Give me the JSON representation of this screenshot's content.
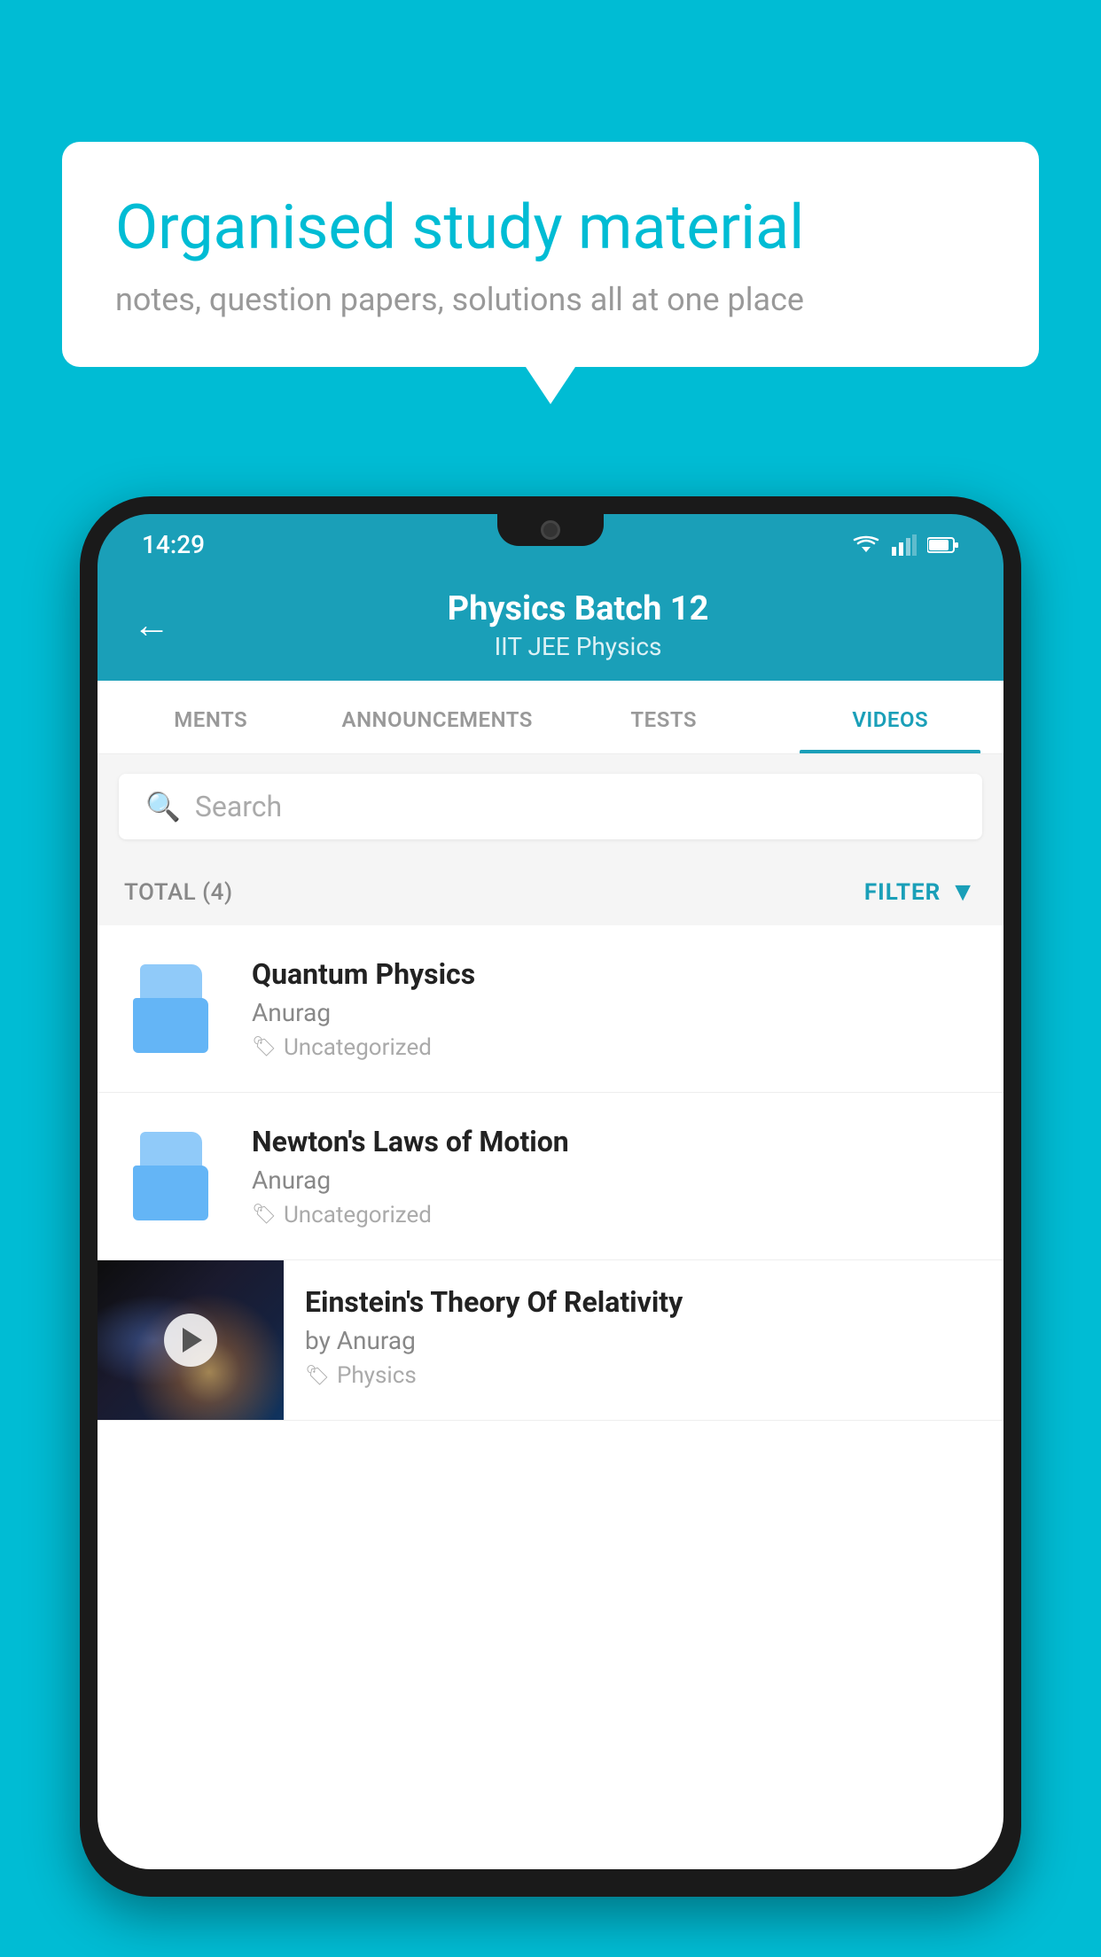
{
  "background": {
    "color": "#00BCD4"
  },
  "speech_bubble": {
    "title": "Organised study material",
    "subtitle": "notes, question papers, solutions all at one place"
  },
  "status_bar": {
    "time": "14:29"
  },
  "app_header": {
    "title": "Physics Batch 12",
    "subtitle": "IIT JEE    Physics",
    "back_label": "←"
  },
  "tabs": [
    {
      "label": "MENTS",
      "active": false
    },
    {
      "label": "ANNOUNCEMENTS",
      "active": false
    },
    {
      "label": "TESTS",
      "active": false
    },
    {
      "label": "VIDEOS",
      "active": true
    }
  ],
  "search": {
    "placeholder": "Search"
  },
  "filter_bar": {
    "total_label": "TOTAL (4)",
    "filter_label": "FILTER"
  },
  "videos": [
    {
      "id": "quantum-physics",
      "title": "Quantum Physics",
      "author": "Anurag",
      "tag": "Uncategorized",
      "type": "folder"
    },
    {
      "id": "newtons-laws",
      "title": "Newton's Laws of Motion",
      "author": "Anurag",
      "tag": "Uncategorized",
      "type": "folder"
    },
    {
      "id": "einsteins-theory",
      "title": "Einstein's Theory Of Relativity",
      "author": "by Anurag",
      "tag": "Physics",
      "type": "video"
    }
  ]
}
